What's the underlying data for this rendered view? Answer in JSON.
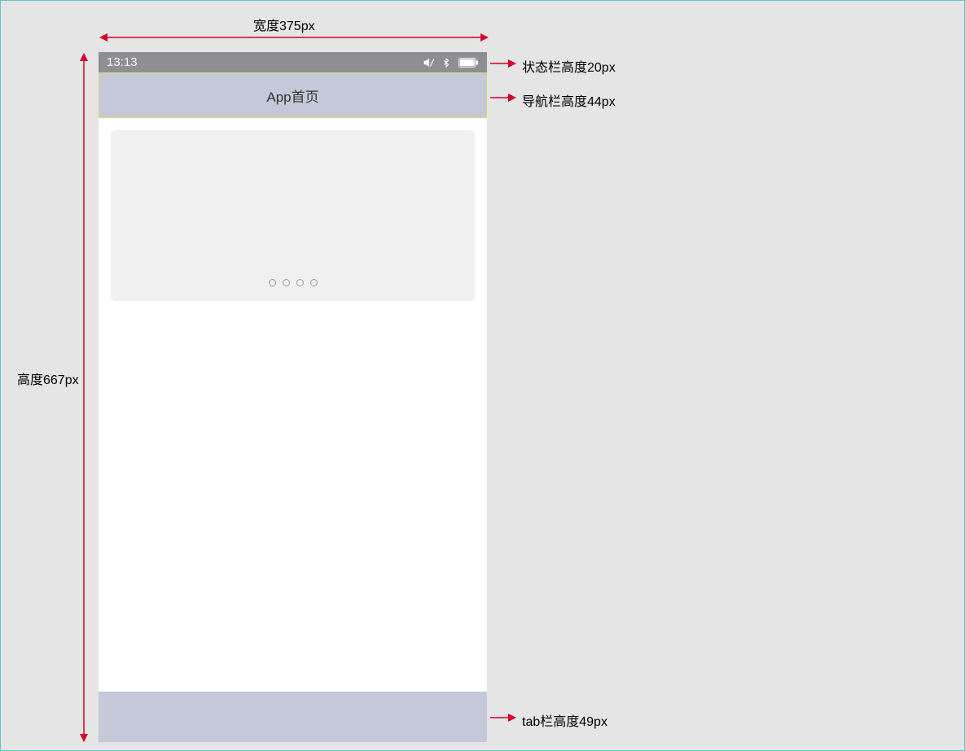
{
  "labels": {
    "width_top": "宽度375px",
    "height_left": "高度667px",
    "status_label": "状态栏高度20px",
    "nav_label": "导航栏高度44px",
    "tab_label": "tab栏高度49px"
  },
  "statusbar": {
    "time": "13:13"
  },
  "navbar": {
    "title": "App首页"
  },
  "dimensions": {
    "device_width_pt": 375,
    "device_height_pt": 667,
    "status_bar_pt": 20,
    "nav_bar_pt": 44,
    "tab_bar_pt": 49
  }
}
